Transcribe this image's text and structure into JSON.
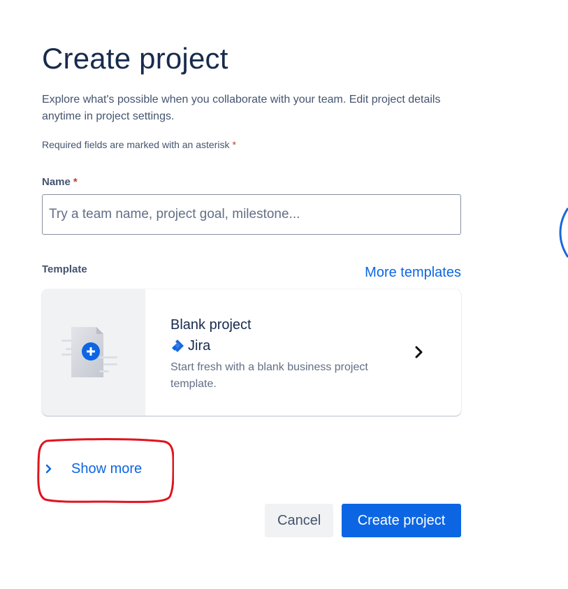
{
  "page": {
    "title": "Create project",
    "description": "Explore what's possible when you collaborate with your team. Edit project details anytime in project settings.",
    "required_note": "Required fields are marked with an asterisk",
    "asterisk": "*"
  },
  "form": {
    "name_label": "Name",
    "name_value": "",
    "name_placeholder": "Try a team name, project goal, milestone...",
    "template_label": "Template",
    "more_templates_link": "More templates"
  },
  "template_card": {
    "title": "Blank project",
    "product": "Jira",
    "description": "Start fresh with a blank business project template.",
    "thumbnail_icon": "blank-document-plus-icon",
    "product_icon": "jira-logo-icon",
    "action_icon": "chevron-right-icon"
  },
  "show_more": {
    "label": "Show more",
    "icon": "chevron-right-icon"
  },
  "actions": {
    "cancel_label": "Cancel",
    "create_label": "Create project"
  },
  "colors": {
    "primary": "#0c66e4",
    "text": "#172b4d",
    "subtle_text": "#44546f",
    "required": "#c9372c",
    "annotation": "#e0141e"
  }
}
